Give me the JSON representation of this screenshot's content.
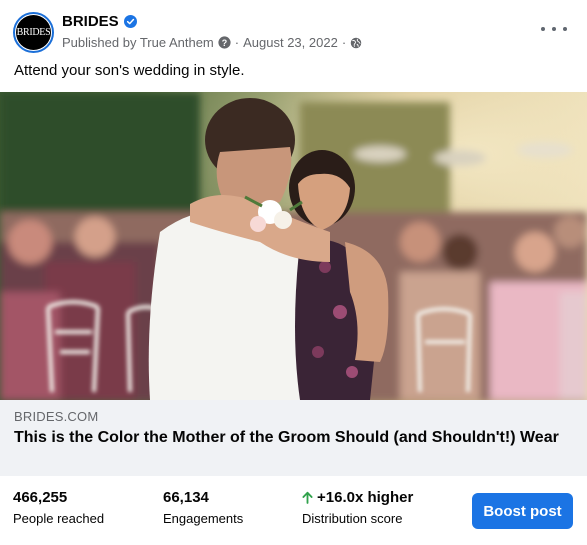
{
  "post": {
    "page_name": "BRIDES",
    "avatar_text": "BRIDES",
    "published_by": "Published by True Anthem",
    "date": "August 23, 2022",
    "separator": "·",
    "caption": "Attend your son's wedding in style.",
    "verified_icon": "verified-badge-icon",
    "globe_icon": "globe-icon",
    "help_icon": "question-circle-icon",
    "more_icon": "more-horizontal-icon"
  },
  "link_preview": {
    "domain": "BRIDES.COM",
    "title": "This is the Color the Mother of the Groom Should (and Shouldn't!) Wear"
  },
  "insights": {
    "people_reached": {
      "value": "466,255",
      "label": "People reached"
    },
    "engagements": {
      "value": "66,134",
      "label": "Engagements"
    },
    "distribution": {
      "value": "+16.0x higher",
      "label": "Distribution score",
      "arrow_icon": "arrow-up-icon",
      "arrow_color": "#31a24c"
    }
  },
  "actions": {
    "boost_label": "Boost post"
  },
  "colors": {
    "accent": "#1b74e4",
    "verified": "#1b74e4",
    "muted_text": "#65676b",
    "preview_bg": "#f0f2f5"
  }
}
